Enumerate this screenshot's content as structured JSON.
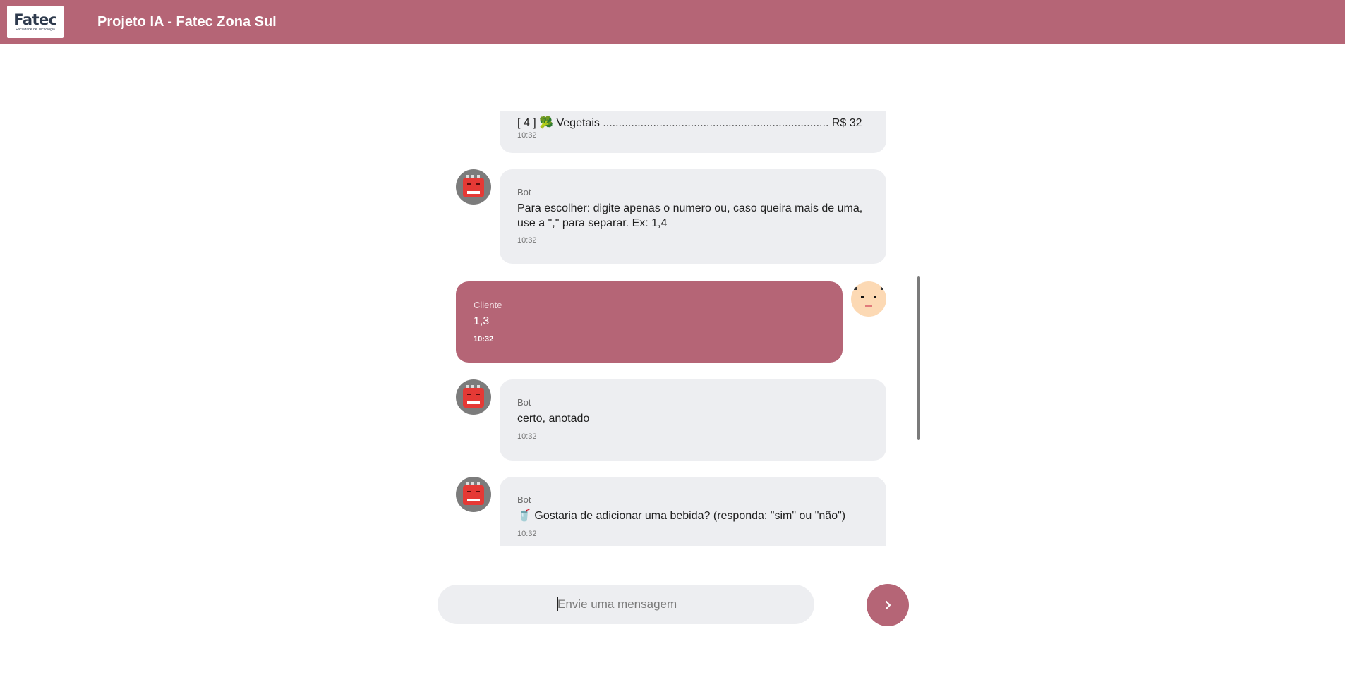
{
  "header": {
    "logo_text": "Fatec",
    "logo_subtext": "Faculdade de Tecnologia",
    "title": "Projeto IA - Fatec Zona Sul"
  },
  "messages": [
    {
      "sender": "",
      "text": "[ 4 ] 🥦 Vegetais ........................................................................ R$ 32",
      "time": "10:32",
      "role": "bot"
    },
    {
      "sender": "Bot",
      "text": "Para escolher: digite apenas o numero ou, caso queira mais de uma, use a \",\" para separar. Ex: 1,4",
      "time": "10:32",
      "role": "bot"
    },
    {
      "sender": "Cliente",
      "text": "1,3",
      "time": "10:32",
      "role": "user"
    },
    {
      "sender": "Bot",
      "text": "certo, anotado",
      "time": "10:32",
      "role": "bot"
    },
    {
      "sender": "Bot",
      "text": "🥤 Gostaria de adicionar uma bebida? (responda: \"sim\" ou \"não\")",
      "time": "10:32",
      "role": "bot"
    }
  ],
  "composer": {
    "placeholder": "Envie uma mensagem",
    "value": ""
  },
  "icons": {
    "send": "chevron-right-icon",
    "bot_avatar": "robot-avatar-icon",
    "user_avatar": "face-avatar-icon"
  },
  "colors": {
    "brand": "#b56576",
    "bot_bubble": "#edeef1",
    "user_bubble": "#b56576"
  }
}
